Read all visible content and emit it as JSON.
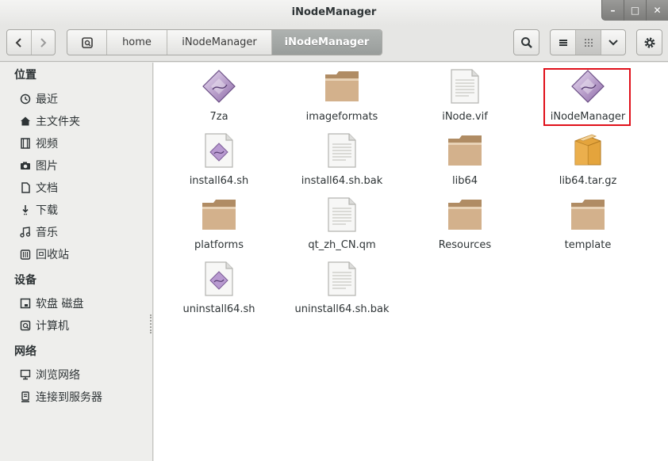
{
  "window": {
    "title": "iNodeManager",
    "buttons": {
      "minimize": "–",
      "maximize": "□",
      "close": "✕"
    }
  },
  "toolbar": {
    "breadcrumbs": [
      "home",
      "iNodeManager",
      "iNodeManager"
    ],
    "active_crumb_index": 2
  },
  "sidebar": {
    "sections": [
      {
        "heading": "位置",
        "items": [
          "最近",
          "主文件夹",
          "视频",
          "图片",
          "文档",
          "下载",
          "音乐",
          "回收站"
        ]
      },
      {
        "heading": "设备",
        "items": [
          "软盘 磁盘",
          "计算机"
        ]
      },
      {
        "heading": "网络",
        "items": [
          "浏览网络",
          "连接到服务器"
        ]
      }
    ]
  },
  "files": [
    {
      "name": "7za",
      "icon": "executable-icon"
    },
    {
      "name": "imageformats",
      "icon": "folder-icon"
    },
    {
      "name": "iNode.vif",
      "icon": "text-file-icon"
    },
    {
      "name": "iNodeManager",
      "icon": "executable-icon",
      "selected": true
    },
    {
      "name": "install64.sh",
      "icon": "script-icon"
    },
    {
      "name": "install64.sh.bak",
      "icon": "text-file-icon"
    },
    {
      "name": "lib64",
      "icon": "folder-icon"
    },
    {
      "name": "lib64.tar.gz",
      "icon": "archive-icon"
    },
    {
      "name": "platforms",
      "icon": "folder-icon"
    },
    {
      "name": "qt_zh_CN.qm",
      "icon": "text-file-icon"
    },
    {
      "name": "Resources",
      "icon": "folder-icon"
    },
    {
      "name": "template",
      "icon": "folder-icon"
    },
    {
      "name": "uninstall64.sh",
      "icon": "script-icon"
    },
    {
      "name": "uninstall64.sh.bak",
      "icon": "text-file-icon"
    }
  ],
  "colors": {
    "highlight": "#e0101a",
    "accent": "#999d9b",
    "folder": "#c9a67e"
  }
}
